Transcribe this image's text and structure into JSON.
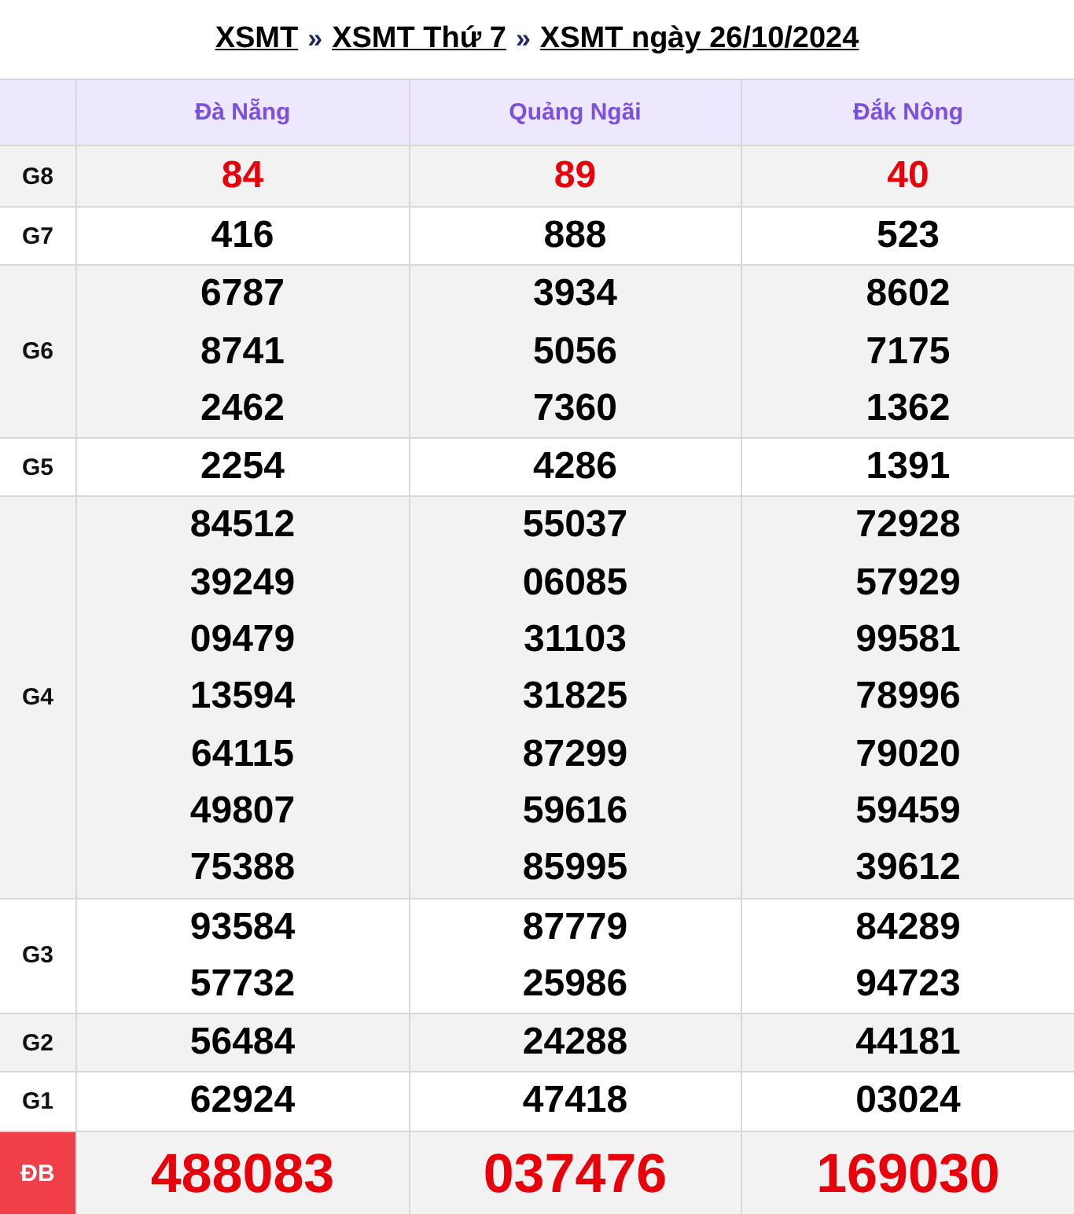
{
  "breadcrumb": [
    {
      "label": "XSMT"
    },
    {
      "label": "XSMT Thứ 7"
    },
    {
      "label": "XSMT ngày 26/10/2024"
    }
  ],
  "separator": "»",
  "provinces": [
    "Đà Nẵng",
    "Quảng Ngãi",
    "Đắk Nông"
  ],
  "prizes": [
    {
      "label": "G8",
      "kind": "highlight",
      "numbers": [
        [
          "84"
        ],
        [
          "89"
        ],
        [
          "40"
        ]
      ]
    },
    {
      "label": "G7",
      "kind": "normal",
      "numbers": [
        [
          "416"
        ],
        [
          "888"
        ],
        [
          "523"
        ]
      ]
    },
    {
      "label": "G6",
      "kind": "normal",
      "numbers": [
        [
          "6787",
          "8741",
          "2462"
        ],
        [
          "3934",
          "5056",
          "7360"
        ],
        [
          "8602",
          "7175",
          "1362"
        ]
      ]
    },
    {
      "label": "G5",
      "kind": "normal",
      "numbers": [
        [
          "2254"
        ],
        [
          "4286"
        ],
        [
          "1391"
        ]
      ]
    },
    {
      "label": "G4",
      "kind": "normal",
      "numbers": [
        [
          "84512",
          "39249",
          "09479",
          "13594",
          "64115",
          "49807",
          "75388"
        ],
        [
          "55037",
          "06085",
          "31103",
          "31825",
          "87299",
          "59616",
          "85995"
        ],
        [
          "72928",
          "57929",
          "99581",
          "78996",
          "79020",
          "59459",
          "39612"
        ]
      ]
    },
    {
      "label": "G3",
      "kind": "normal",
      "numbers": [
        [
          "93584",
          "57732"
        ],
        [
          "87779",
          "25986"
        ],
        [
          "84289",
          "94723"
        ]
      ]
    },
    {
      "label": "G2",
      "kind": "normal",
      "numbers": [
        [
          "56484"
        ],
        [
          "24288"
        ],
        [
          "44181"
        ]
      ]
    },
    {
      "label": "G1",
      "kind": "normal",
      "numbers": [
        [
          "62924"
        ],
        [
          "47418"
        ],
        [
          "03024"
        ]
      ]
    },
    {
      "label": "ĐB",
      "kind": "special",
      "numbers": [
        [
          "488083"
        ],
        [
          "037476"
        ],
        [
          "169030"
        ]
      ]
    }
  ]
}
